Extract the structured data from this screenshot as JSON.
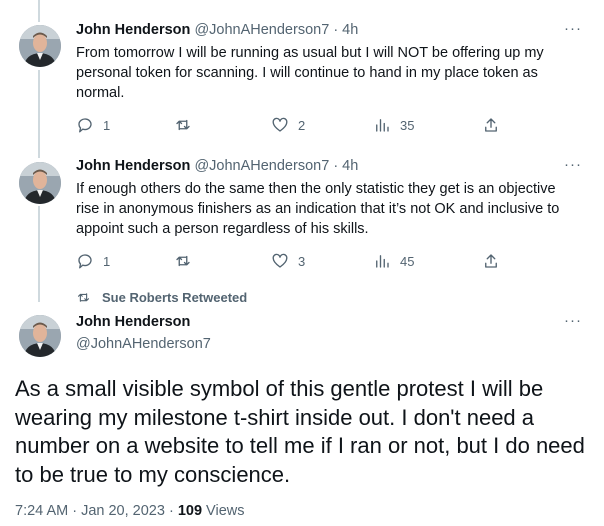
{
  "tweets": [
    {
      "name": "John Henderson",
      "handle": "@JohnAHenderson7",
      "time": "· 4h",
      "more": "···",
      "text": "From tomorrow I will be running as usual but I will NOT be offering up my personal token for scanning. I will continue to hand in my place token as normal.",
      "replies": "1",
      "retweets": "",
      "likes": "2",
      "views": "35"
    },
    {
      "name": "John Henderson",
      "handle": "@JohnAHenderson7",
      "time": "· 4h",
      "more": "···",
      "text": "If enough others do the same then the only statistic they get is an objective rise in anonymous finishers as an indication that it’s not OK and inclusive to appoint such a person regardless of his skills.",
      "replies": "1",
      "retweets": "",
      "likes": "3",
      "views": "45"
    }
  ],
  "retweeted_by": "Sue Roberts Retweeted",
  "main_tweet": {
    "name": "John Henderson",
    "handle": "@JohnAHenderson7",
    "more": "···",
    "text": "As a small visible symbol of this gentle protest I will be wearing my milestone t-shirt inside out. I don't need a number on a website to tell me if I ran or not, but I do need to be true to my conscience.",
    "time": "7:24 AM · Jan 20, 2023 · ",
    "views_count": "109",
    "views_label": " Views"
  },
  "icons": [
    "reply-icon",
    "retweet-icon",
    "like-icon",
    "views-icon",
    "share-icon",
    "more-icon"
  ],
  "colors": {
    "text": "#0f1419",
    "secondary": "#536471",
    "thread_line": "#cfd9de"
  }
}
